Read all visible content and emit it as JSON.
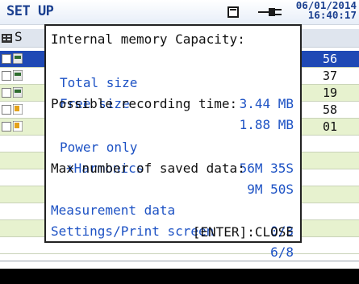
{
  "header": {
    "title": "SET UP",
    "date": "06/01/2014",
    "time": "16:40:17"
  },
  "list": {
    "header_fragment": "S",
    "rows": [
      {
        "fragment": "56",
        "selected": true
      },
      {
        "fragment": "37",
        "selected": false
      },
      {
        "fragment": "19",
        "selected": false
      },
      {
        "fragment": "58",
        "selected": false
      },
      {
        "fragment": "01",
        "selected": false
      }
    ]
  },
  "dialog": {
    "capacity_heading": "Internal memory Capacity:",
    "total_size_label": "Total size",
    "total_size_value": "3.44 MB",
    "free_size_label": "Free size",
    "free_size_value": "1.88 MB",
    "recording_heading": "Possible recording time:",
    "power_only_label": "Power only",
    "power_only_value": "56M 35S",
    "harmonics_label": "+Harmonics",
    "harmonics_value": "9M 50S",
    "saved_heading": "Max number of saved data:",
    "measurement_label": "Measurement data",
    "measurement_value": "0/3",
    "settings_label": "Settings/Print screen",
    "settings_value": "6/8",
    "close_hint": "[ENTER]:CLOSE"
  },
  "colors": {
    "title_blue": "#1a3f8f",
    "value_blue": "#1d52c4",
    "selected_row": "#1f49b5",
    "row_green": "#e7f2cf"
  },
  "icons": [
    "memory-card-icon",
    "power-plug-icon",
    "tree-icon",
    "file-icon",
    "checkbox-icon"
  ]
}
